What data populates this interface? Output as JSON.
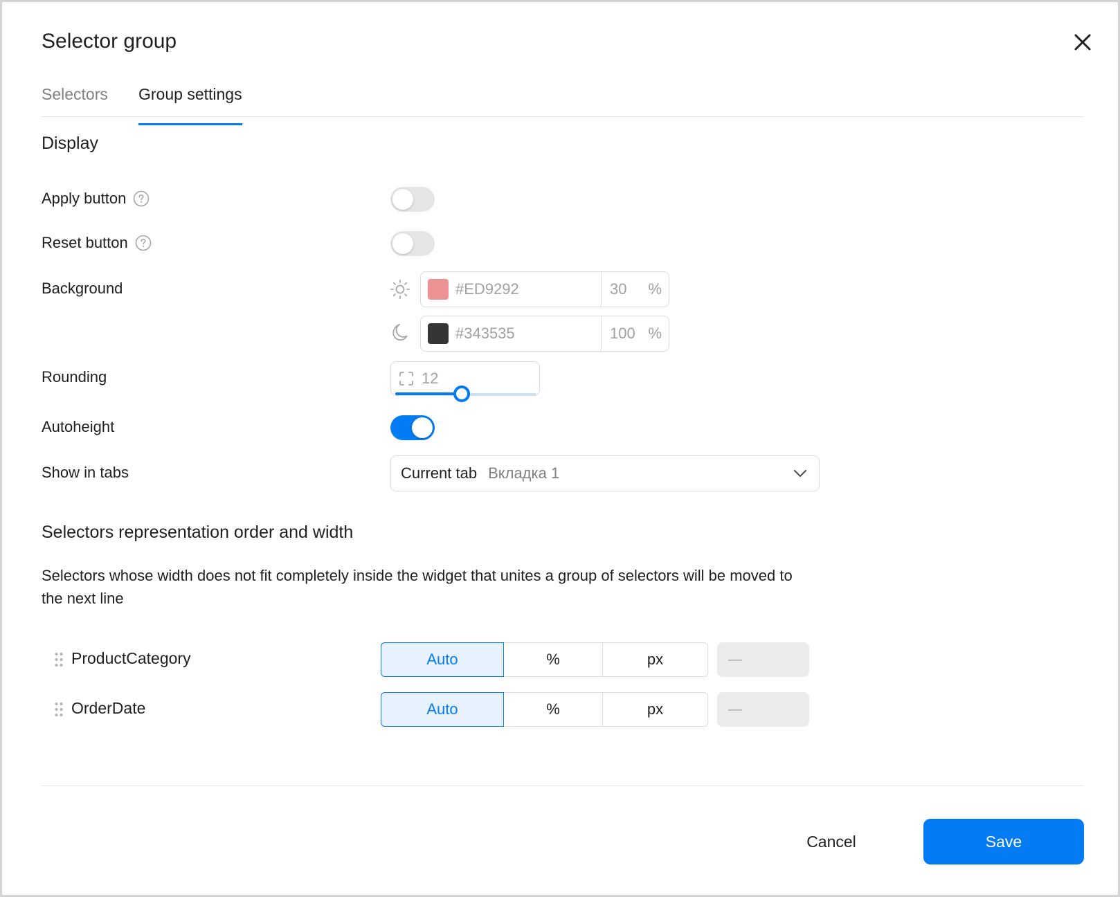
{
  "dialog": {
    "title": "Selector group"
  },
  "tabs": [
    {
      "label": "Selectors",
      "active": false
    },
    {
      "label": "Group settings",
      "active": true
    }
  ],
  "display": {
    "title": "Display",
    "apply_button": {
      "label": "Apply button",
      "enabled": false
    },
    "reset_button": {
      "label": "Reset button",
      "enabled": false
    },
    "background": {
      "label": "Background",
      "light": {
        "icon": "sun-icon",
        "hex": "#ED9292",
        "swatch": "#ED9292",
        "opacity": "30",
        "unit": "%"
      },
      "dark": {
        "icon": "moon-icon",
        "hex": "#343535",
        "swatch": "#343535",
        "opacity": "100",
        "unit": "%"
      }
    },
    "rounding": {
      "label": "Rounding",
      "value": "12",
      "slider_fraction": 0.47
    },
    "autoheight": {
      "label": "Autoheight",
      "enabled": true
    },
    "show_in_tabs": {
      "label": "Show in tabs",
      "value": "Current tab",
      "hint": "Вкладка 1"
    }
  },
  "order": {
    "title": "Selectors representation order and width",
    "description": "Selectors whose width does not fit completely inside the widget that unites a group of selectors will be moved to the next line",
    "options": [
      "Auto",
      "%",
      "px"
    ],
    "selectors": [
      {
        "name": "ProductCategory",
        "selected": "Auto",
        "width": "—"
      },
      {
        "name": "OrderDate",
        "selected": "Auto",
        "width": "—"
      }
    ]
  },
  "footer": {
    "cancel_label": "Cancel",
    "save_label": "Save"
  },
  "colors": {
    "accent": "#027BF3",
    "selected_bg": "#E8F2FE"
  }
}
